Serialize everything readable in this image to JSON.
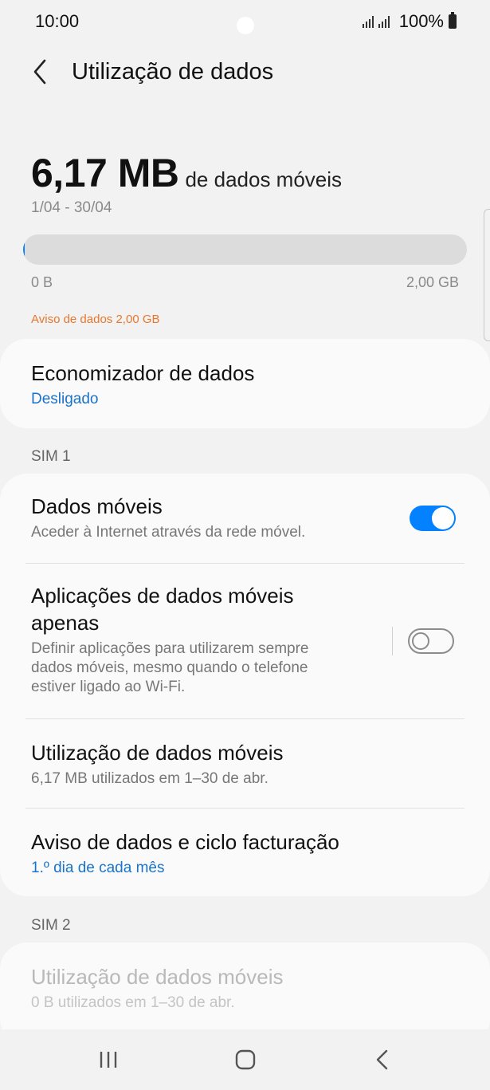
{
  "status_bar": {
    "time": "10:00",
    "battery": "100%"
  },
  "header": {
    "title": "Utilização de dados"
  },
  "usage": {
    "amount": "6,17 MB",
    "suffix": "de dados móveis",
    "period": "1/04 - 30/04",
    "progress_fraction": 0.003,
    "axis_min": "0 B",
    "axis_max": "2,00 GB",
    "warning": "Aviso de dados 2,00 GB"
  },
  "data_saver": {
    "title": "Economizador de dados",
    "status": "Desligado"
  },
  "sim1": {
    "label": "SIM 1",
    "mobile_data": {
      "title": "Dados móveis",
      "subtitle": "Aceder à Internet através da rede móvel.",
      "enabled": true
    },
    "mobile_only_apps": {
      "title_line1": "Aplicações de dados móveis",
      "title_line2": "apenas",
      "subtitle_line1": "Definir aplicações para utilizarem sempre",
      "subtitle_line2": "dados móveis, mesmo quando o telefone",
      "subtitle_line3": "estiver ligado ao Wi-Fi.",
      "enabled": false
    },
    "mobile_usage": {
      "title": "Utilização de dados móveis",
      "subtitle": "6,17 MB utilizados em 1–30 de abr."
    },
    "billing": {
      "title": "Aviso de dados e ciclo facturação",
      "subtitle": "1.º dia de cada mês"
    }
  },
  "sim2": {
    "label": "SIM 2",
    "mobile_usage": {
      "title": "Utilização de dados móveis",
      "subtitle": "0 B utilizados em 1–30 de abr."
    }
  },
  "colors": {
    "accent": "#0381fe",
    "warning": "#e8772e",
    "link": "#1a73c8"
  },
  "icons": {
    "back": "chevron-left-icon",
    "recents": "recents-icon",
    "home": "home-icon",
    "nav_back": "nav-back-icon"
  }
}
